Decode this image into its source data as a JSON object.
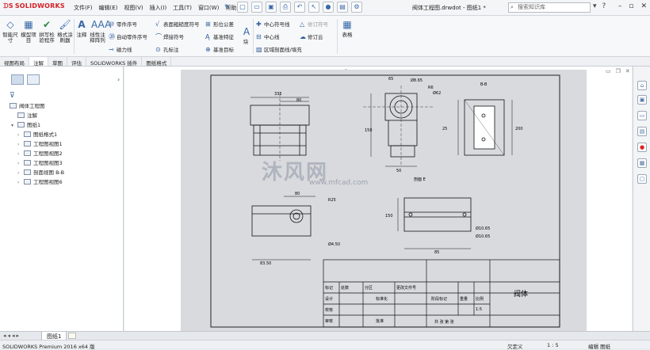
{
  "app": {
    "logo": "SOLIDWORKS",
    "menu": [
      "文件(F)",
      "编辑(E)",
      "视图(V)",
      "插入(I)",
      "工具(T)",
      "窗口(W)",
      "帮助(H)"
    ],
    "doc_title": "阀体工程图.drwdot - 图纸1 *",
    "search_placeholder": "搜索知识库"
  },
  "ribbon": {
    "big": [
      {
        "label": "智能尺寸",
        "icon": "smart-dimension-icon"
      },
      {
        "label": "模型项目",
        "icon": "model-items-icon"
      },
      {
        "label": "拼写检验程序",
        "icon": "spell-check-icon"
      },
      {
        "label": "格式涂刷器",
        "icon": "format-painter-icon"
      },
      {
        "label": "注释",
        "icon": "note-icon"
      },
      {
        "label": "线性注释阵列",
        "icon": "linear-note-pattern-icon"
      },
      {
        "label": "块",
        "icon": "block-icon"
      },
      {
        "label": "表格",
        "icon": "table-icon"
      }
    ],
    "col1": [
      "零件序号",
      "自动零件序号",
      "磁力线"
    ],
    "col2": [
      "表面粗糙度符号",
      "焊接符号",
      "孔标注"
    ],
    "col3": [
      "形位公差",
      "基准特征",
      "基准目标"
    ],
    "col4": [
      "中心符号线",
      "中心线",
      "区域剖面线/填充"
    ],
    "col5": [
      "修订符号",
      "修订云"
    ]
  },
  "tabs": [
    "视图布局",
    "注解",
    "草图",
    "评估",
    "SOLIDWORKS 插件",
    "图纸格式"
  ],
  "active_tab": "注解",
  "tree": {
    "root": "阀体工程图",
    "items": [
      {
        "label": "注解",
        "indent": 1,
        "expand": ""
      },
      {
        "label": "图纸1",
        "indent": 1,
        "expand": "▾"
      },
      {
        "label": "图纸格式1",
        "indent": 2,
        "expand": "›"
      },
      {
        "label": "工程图视图1",
        "indent": 2,
        "expand": "›"
      },
      {
        "label": "工程图视图2",
        "indent": 2,
        "expand": "›"
      },
      {
        "label": "工程图视图3",
        "indent": 2,
        "expand": "›"
      },
      {
        "label": "剖面视图 B-B",
        "indent": 2,
        "expand": "›"
      },
      {
        "label": "工程图视图6",
        "indent": 2,
        "expand": "›"
      }
    ]
  },
  "sheet_tab": "图纸1",
  "status": {
    "product": "SOLIDWORKS Premium 2016 x64 版",
    "state": "欠定义",
    "scale": "1 : 5",
    "edit": "编辑 图纸"
  },
  "drawing": {
    "dims": [
      "335",
      "80",
      "65",
      "Ø8.65",
      "R6",
      "Ø62",
      "150",
      "50",
      "50",
      "25",
      "16",
      "200",
      "B-B",
      "R25",
      "80",
      "Ø4.50",
      "83.50",
      "180",
      "150",
      "Ø10.65",
      "Ø10.65",
      "30",
      "40",
      "20",
      "85",
      "剖面 E"
    ],
    "title_block": {
      "part_name": "阀体",
      "rows": [
        "标记",
        "处数",
        "分区",
        "更改文件号",
        "签名",
        "年.月.日",
        "设计",
        "标准化",
        "阶段标记",
        "重量",
        "比例",
        "校核",
        "审核",
        "工艺",
        "批准",
        "共 张 第 张"
      ],
      "scale_value": "1:5"
    }
  },
  "watermark": {
    "main": "沐风网",
    "sub": "www.mfcad.com"
  },
  "colors": {
    "brand": "#d22128",
    "accent": "#2f5d9b",
    "paper": "#d9dadd"
  }
}
